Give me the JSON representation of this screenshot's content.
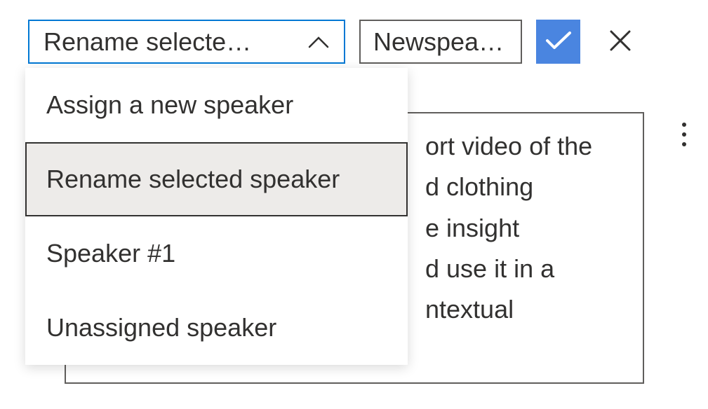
{
  "toolbar": {
    "dropdown_selected": "Rename selecte…",
    "name_input_value": "Newspea…"
  },
  "dropdown_options": [
    {
      "label": "Assign a new speaker",
      "selected": false
    },
    {
      "label": "Rename selected speaker",
      "selected": true
    },
    {
      "label": "Speaker #1",
      "selected": false
    },
    {
      "label": "Unassigned speaker",
      "selected": false
    }
  ],
  "content": {
    "lines": [
      "ort video of the",
      "d clothing",
      "e insight",
      "d use it in a",
      "ntextual"
    ]
  }
}
